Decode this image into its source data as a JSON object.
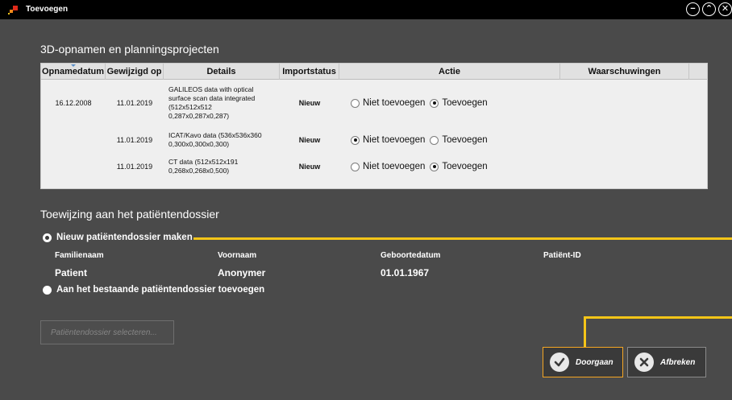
{
  "window": {
    "title": "Toevoegen",
    "controls": {
      "minimize": "−",
      "restore": "⌃",
      "close": "✕"
    }
  },
  "section_scans": {
    "title": "3D-opnamen en planningsprojecten",
    "columns": [
      "Opnamedatum",
      "Gewijzigd op",
      "Details",
      "Importstatus",
      "Actie",
      "Waarschuwingen"
    ],
    "rows": [
      {
        "opnamedatum": "16.12.2008",
        "gewijzigd": "11.01.2019",
        "details": [
          "GALILEOS data with optical",
          "surface scan data integrated",
          "(512x512x512",
          "0,287x0,287x0,287)"
        ],
        "status": "Nieuw",
        "option_a": "Niet toevoegen",
        "option_b": "Toevoegen",
        "selected": "b"
      },
      {
        "opnamedatum": "",
        "gewijzigd": "11.01.2019",
        "details": [
          "ICAT/Kavo data (536x536x360",
          "0,300x0,300x0,300)"
        ],
        "status": "Nieuw",
        "option_a": "Niet toevoegen",
        "option_b": "Toevoegen",
        "selected": "a"
      },
      {
        "opnamedatum": "",
        "gewijzigd": "11.01.2019",
        "details": [
          "CT data (512x512x191",
          "0,268x0,268x0,500)"
        ],
        "status": "Nieuw",
        "option_a": "Niet toevoegen",
        "option_b": "Toevoegen",
        "selected": "b"
      }
    ]
  },
  "section_assign": {
    "title": "Toewijzing aan het patiëntendossier",
    "new_option": "Nieuw patiëntendossier maken",
    "existing_option": "Aan het bestaande patiëntendossier toevoegen",
    "selected": "new",
    "columns": [
      "Familienaam",
      "Voornaam",
      "Geboortedatum",
      "Patiënt-ID"
    ],
    "values": [
      "Patient",
      "Anonymer",
      "01.01.1967",
      ""
    ],
    "select_button": "Patiëntendossier selecteren..."
  },
  "buttons": {
    "continue": "Doorgaan",
    "cancel": "Afbreken"
  },
  "colors": {
    "accent_line": "#f5c518",
    "primary_border": "#f5a623",
    "background": "#4a4a4a"
  },
  "icons": {
    "continue": "check-icon",
    "cancel": "x-icon",
    "app": "app-logo-icon"
  }
}
